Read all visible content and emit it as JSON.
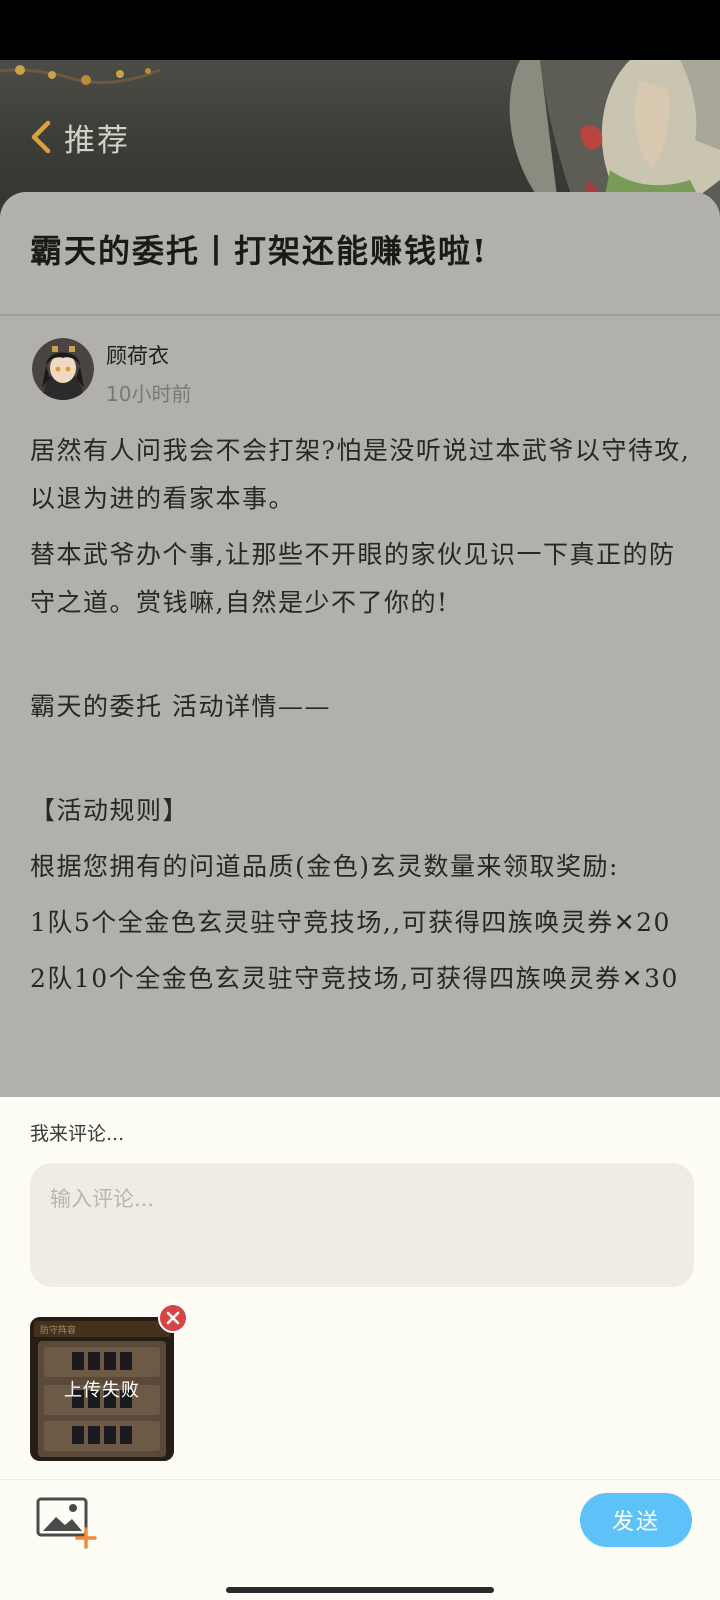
{
  "header": {
    "back_label": "推荐"
  },
  "post": {
    "title": "霸天的委托丨打架还能赚钱啦!",
    "author": {
      "name": "顾荷衣",
      "time": "10小时前"
    },
    "paragraphs": [
      "居然有人问我会不会打架?怕是没听说过本武爷以守待攻,以退为进的看家本事。",
      "替本武爷办个事,让那些不开眼的家伙见识一下真正的防守之道。赏钱嘛,自然是少不了你的!",
      "霸天的委托 活动详情——",
      "【活动规则】",
      "根据您拥有的问道品质(金色)玄灵数量来领取奖励:",
      "1队5个全金色玄灵驻守竞技场,,可获得四族唤灵券✕20",
      "2队10个全金色玄灵驻守竞技场,可获得四族唤灵券✕30"
    ]
  },
  "composer": {
    "heading": "我来评论...",
    "input_placeholder": "输入评论...",
    "attachment": {
      "status": "上传失败",
      "thumb_label": "防守阵容"
    },
    "send_label": "发送"
  },
  "colors": {
    "sheet_bg": "#b2b0ac",
    "composer_bg": "#fdfcf5",
    "send_button": "#5cc2f8",
    "remove_badge": "#d64545"
  }
}
